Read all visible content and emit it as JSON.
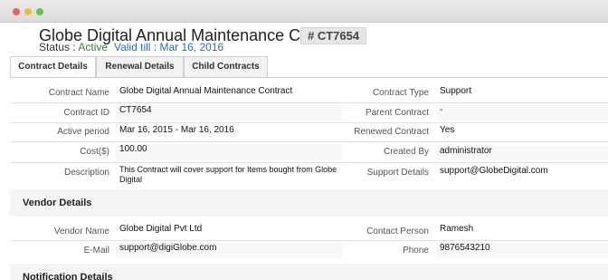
{
  "window": {
    "controls": [
      "close",
      "minimize",
      "maximize"
    ],
    "colors": {
      "close": "#ee5e57",
      "minimize": "#f4bb41",
      "maximize": "#5ec74a"
    }
  },
  "header": {
    "title": "Globe Digital Annual Maintenance Contract",
    "id_badge": "# CT7654",
    "status_label": "Status : ",
    "status_value": "Active",
    "valid_till": "Valid till : Mar 16, 2016"
  },
  "tabs": [
    {
      "label": "Contract Details",
      "active": true
    },
    {
      "label": "Renewal Details",
      "active": false
    },
    {
      "label": "Child Contracts",
      "active": false
    }
  ],
  "contract_details": {
    "left": [
      {
        "label": "Contract Name",
        "value": "Globe Digital Annual Maintenance Contract"
      },
      {
        "label": "Contract ID",
        "value": "CT7654"
      },
      {
        "label": "Active period",
        "value": "Mar 16, 2015 - Mar 16, 2016"
      },
      {
        "label": "Cost($)",
        "value": "100.00"
      },
      {
        "label": "Description",
        "value": "This Contract will cover support for Items bought from Globe Digital"
      }
    ],
    "right": [
      {
        "label": "Contract Type",
        "value": "Support"
      },
      {
        "label": "Parent Contract",
        "value": "-"
      },
      {
        "label": "Renewed Contract",
        "value": "Yes"
      },
      {
        "label": "Created By",
        "value": "administrator"
      },
      {
        "label": "Support Details",
        "value": "support@GlobeDigital.com"
      }
    ]
  },
  "vendor_details": {
    "title": "Vendor Details",
    "left": [
      {
        "label": "Vendor Name",
        "value": "Globe Digital Pvt Ltd"
      },
      {
        "label": "E-Mail",
        "value": "support@digiGlobe.com"
      }
    ],
    "right": [
      {
        "label": "Contact Person",
        "value": "Ramesh"
      },
      {
        "label": "Phone",
        "value": "9876543210"
      }
    ]
  },
  "notification_details": {
    "title": "Notification Details"
  },
  "colors": {
    "status_active": "#2e8a2e",
    "valid_till": "#2e6cb4"
  }
}
